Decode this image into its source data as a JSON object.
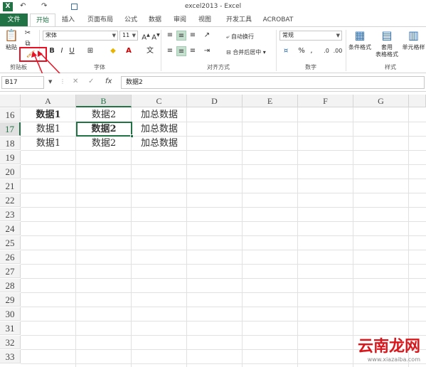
{
  "titlebar": {
    "app_icon": "X",
    "title": "excel2013 - Excel"
  },
  "qat": {
    "save_icon": "save-icon",
    "undo": "↶",
    "redo": "↷"
  },
  "tabs": [
    {
      "label": "文件"
    },
    {
      "label": "开始"
    },
    {
      "label": "插入"
    },
    {
      "label": "页面布局"
    },
    {
      "label": "公式"
    },
    {
      "label": "数据"
    },
    {
      "label": "审阅"
    },
    {
      "label": "视图"
    },
    {
      "label": "开发工具"
    },
    {
      "label": "ACROBAT"
    }
  ],
  "ribbon": {
    "clipboard": {
      "paste_label": "粘贴",
      "group_label": "剪贴板"
    },
    "font": {
      "name": "宋体",
      "size": "11",
      "bold": "B",
      "italic": "I",
      "underline": "U",
      "group_label": "字体",
      "color_a": "A"
    },
    "alignment": {
      "wrap_label": "自动换行",
      "merge_label": "合并后居中",
      "group_label": "对齐方式"
    },
    "number": {
      "format": "常规",
      "percent": "%",
      "comma": ",",
      "group_label": "数字"
    },
    "styles": {
      "conditional_label": "条件格式",
      "table_label_1": "套用",
      "table_label_2": "表格格式",
      "cell_styles_label": "单元格样",
      "group_label": "样式"
    }
  },
  "formula_bar": {
    "name_box": "B17",
    "fx": "fx",
    "cancel": "✕",
    "enter": "✓",
    "value": "数据2"
  },
  "grid": {
    "columns": [
      "A",
      "B",
      "C",
      "D",
      "E",
      "F",
      "G"
    ],
    "rows": [
      "16",
      "17",
      "18",
      "19",
      "20",
      "21",
      "22",
      "23",
      "24",
      "25",
      "26",
      "27",
      "28",
      "29",
      "30",
      "31",
      "32",
      "33"
    ],
    "cells": {
      "r16": [
        "数据1",
        "数据2",
        "加总数据"
      ],
      "r17": [
        "数据1",
        "数据2",
        "加总数据"
      ],
      "r18": [
        "数据1",
        "数据2",
        "加总数据"
      ]
    },
    "selected_column": "B",
    "selected_row": "17"
  },
  "watermark": {
    "text": "云南龙网",
    "sub": "www.xiazaiba.com"
  }
}
